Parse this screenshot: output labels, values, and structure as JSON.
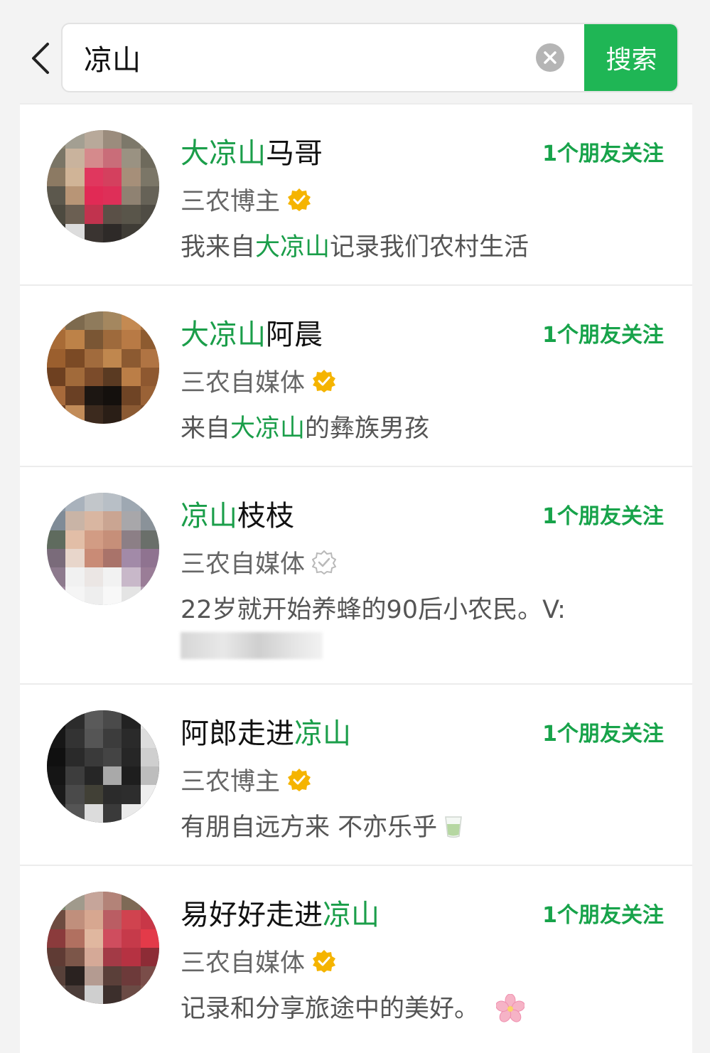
{
  "search": {
    "query": "凉山",
    "button_label": "搜索"
  },
  "icons": {
    "back": "chevron-left-icon",
    "clear": "clear-circle-icon",
    "verified": "verified-badge-icon"
  },
  "colors": {
    "accent": "#1fb655",
    "highlight": "#1b9e4a",
    "verified_gold": "#f5b400",
    "verified_gray": "#b9b9b9"
  },
  "results": [
    {
      "name_hl": "大凉山",
      "name_rest": "马哥",
      "friends": "1个朋友关注",
      "tagline": "三农博主",
      "verified": "gold",
      "desc_pre": "我来自",
      "desc_hl": "大凉山",
      "desc_post": "记录我们农村生活"
    },
    {
      "name_hl": "大凉山",
      "name_rest": "阿晨",
      "friends": "1个朋友关注",
      "tagline": "三农自媒体",
      "verified": "gold",
      "desc_pre": "来自",
      "desc_hl": "大凉山",
      "desc_post": "的彝族男孩"
    },
    {
      "name_hl": "凉山",
      "name_rest": "枝枝",
      "friends": "1个朋友关注",
      "tagline": "三农自媒体",
      "verified": "gray",
      "desc_pre": "22岁就开始养蜂的90后小农民。V:",
      "desc_hl": "",
      "desc_post": ""
    },
    {
      "name_pre": "阿郎走进",
      "name_hl": "凉山",
      "friends": "1个朋友关注",
      "tagline": "三农博主",
      "verified": "gold",
      "desc_pre": "有朋自远方来 不亦乐乎",
      "desc_hl": "",
      "desc_post": ""
    },
    {
      "name_pre": "易好好走进",
      "name_hl": "凉山",
      "friends": "1个朋友关注",
      "tagline": "三农自媒体",
      "verified": "gold",
      "desc_pre": "记录和分享旅途中的美好。",
      "desc_hl": "",
      "desc_post": ""
    }
  ]
}
